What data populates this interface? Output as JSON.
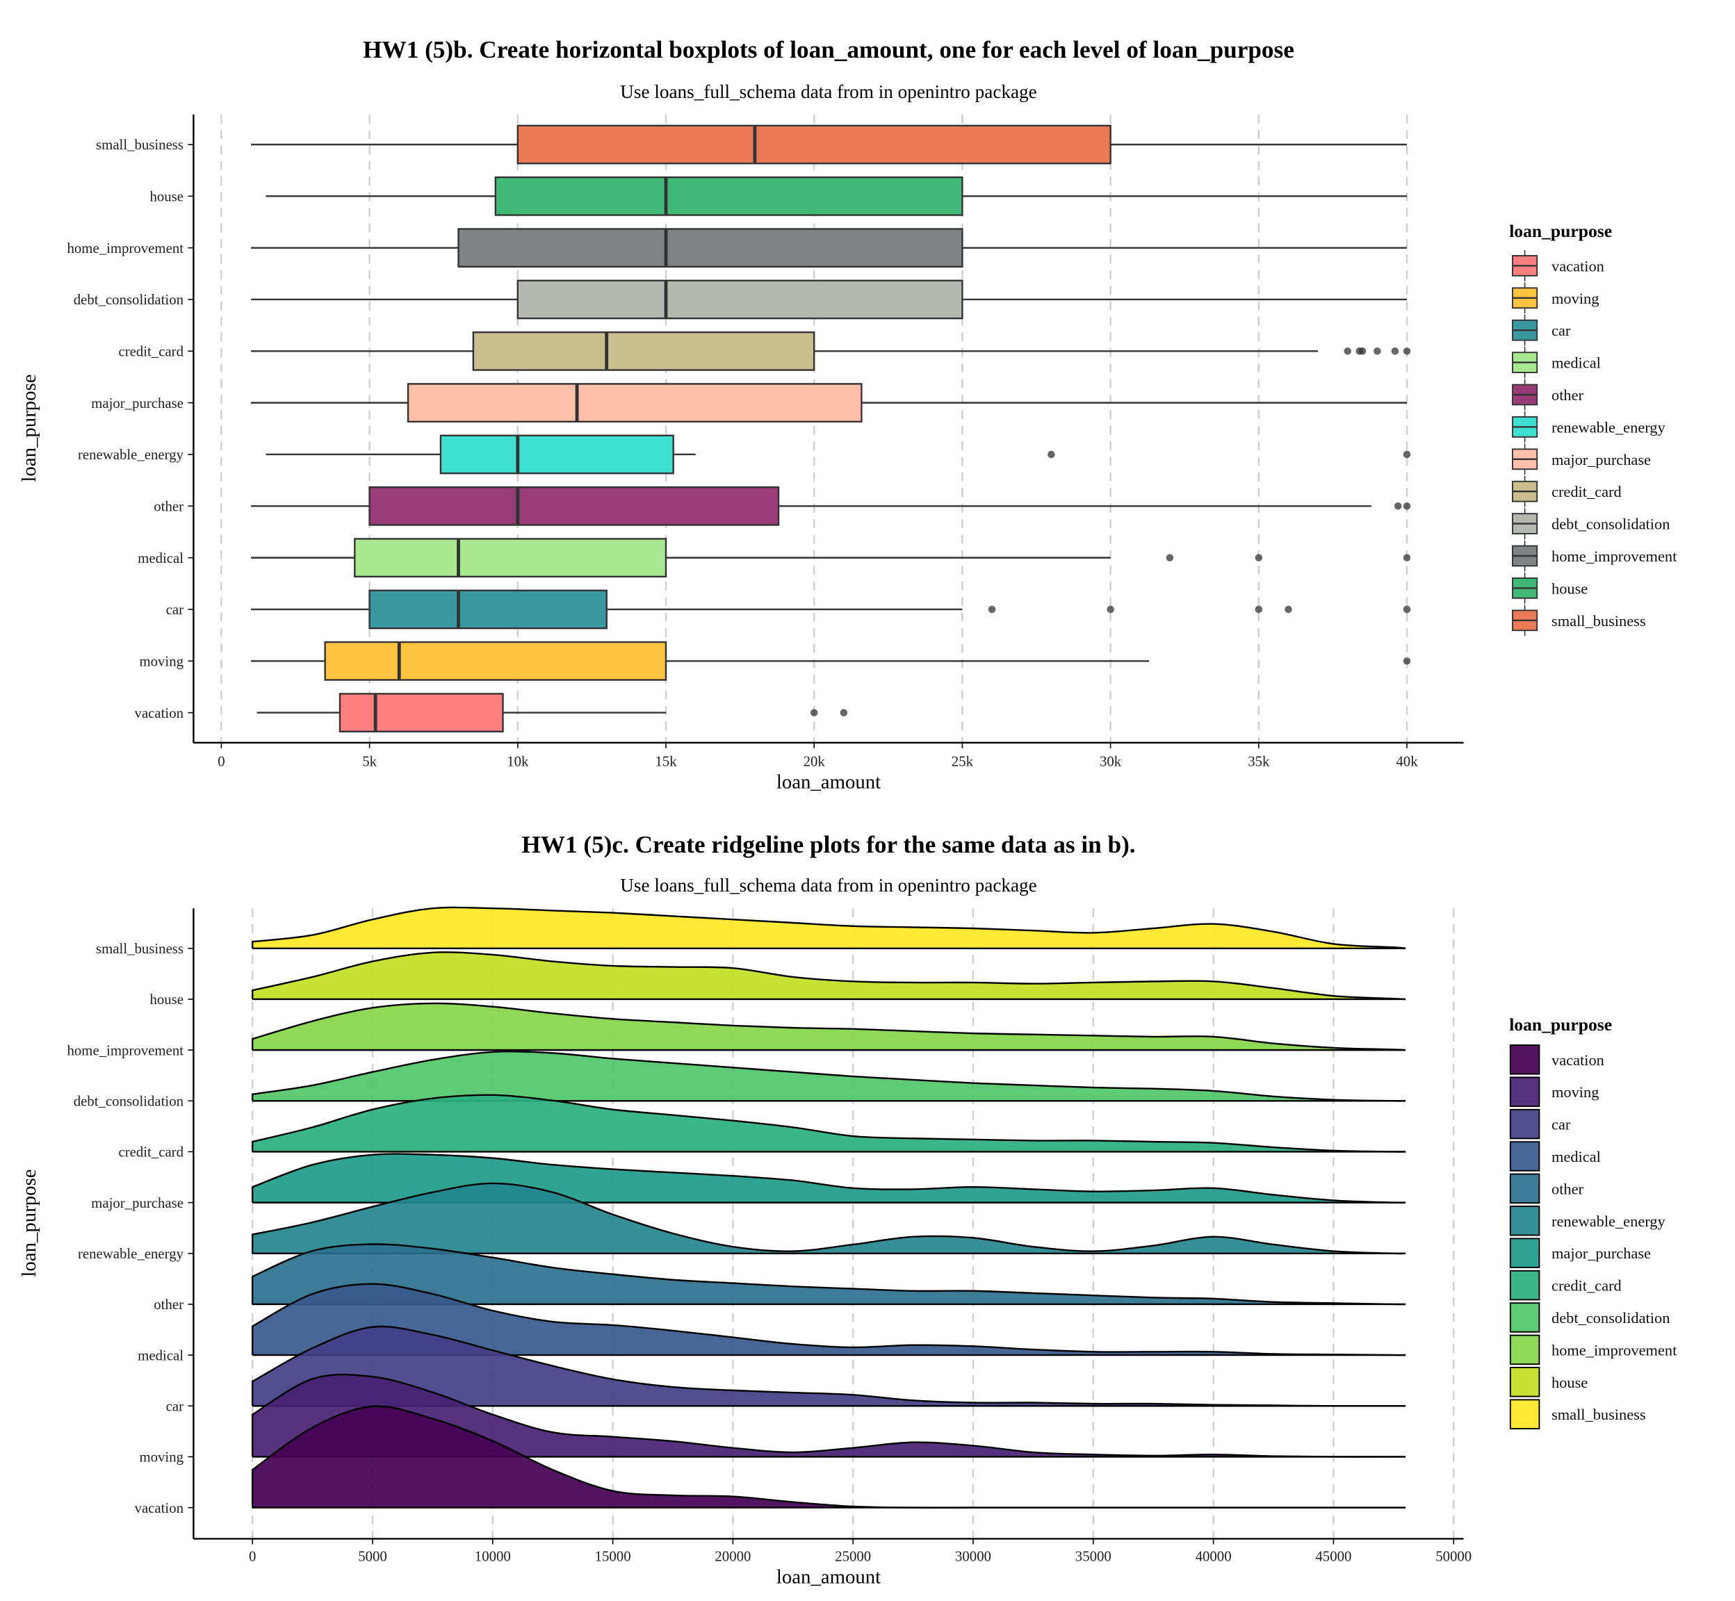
{
  "chart_data": [
    {
      "type": "boxplot",
      "orientation": "horizontal",
      "title": "HW1 (5)b. Create horizontal boxplots of loan_amount, one for each level of loan_purpose",
      "subtitle": "Use loans_full_schema data from in openintro package",
      "xlabel": "loan_amount",
      "ylabel": "loan_purpose",
      "xlim": [
        0,
        40000
      ],
      "x_ticks": [
        0,
        5000,
        10000,
        15000,
        20000,
        25000,
        30000,
        35000,
        40000
      ],
      "x_tick_labels": [
        "0",
        "5k",
        "10k",
        "15k",
        "20k",
        "25k",
        "30k",
        "35k",
        "40k"
      ],
      "grid": "vertical dashed at major x ticks",
      "legend": {
        "title": "loan_purpose",
        "position": "right"
      },
      "categories": [
        "vacation",
        "moving",
        "car",
        "medical",
        "other",
        "renewable_energy",
        "major_purchase",
        "credit_card",
        "debt_consolidation",
        "home_improvement",
        "house",
        "small_business"
      ],
      "series": [
        {
          "name": "vacation",
          "color": "#FF8080",
          "whisker_low": 1200,
          "q1": 4000,
          "median": 5200,
          "q3": 9500,
          "whisker_high": 15000,
          "outliers": [
            20000,
            21000
          ]
        },
        {
          "name": "moving",
          "color": "#FFC440",
          "whisker_low": 1000,
          "q1": 3500,
          "median": 6000,
          "q3": 15000,
          "whisker_high": 31300,
          "outliers": [
            40000
          ]
        },
        {
          "name": "car",
          "color": "#3A98A0",
          "whisker_low": 1000,
          "q1": 5000,
          "median": 8000,
          "q3": 13000,
          "whisker_high": 25000,
          "outliers": [
            26000,
            30000,
            35000,
            36000,
            40000
          ]
        },
        {
          "name": "medical",
          "color": "#A8E890",
          "whisker_low": 1000,
          "q1": 4500,
          "median": 8000,
          "q3": 15000,
          "whisker_high": 30000,
          "outliers": [
            32000,
            35000,
            40000
          ]
        },
        {
          "name": "other",
          "color": "#9A3C78",
          "whisker_low": 1000,
          "q1": 5000,
          "median": 10000,
          "q3": 18800,
          "whisker_high": 38800,
          "outliers": [
            39700,
            40000
          ]
        },
        {
          "name": "renewable_energy",
          "color": "#40E0D0",
          "whisker_low": 1500,
          "q1": 7400,
          "median": 10000,
          "q3": 15250,
          "whisker_high": 16000,
          "outliers": [
            28000,
            40000
          ]
        },
        {
          "name": "major_purchase",
          "color": "#FFBFAA",
          "whisker_low": 1000,
          "q1": 6300,
          "median": 12000,
          "q3": 21600,
          "whisker_high": 40000,
          "outliers": []
        },
        {
          "name": "credit_card",
          "color": "#C8BE8E",
          "whisker_low": 1000,
          "q1": 8500,
          "median": 13000,
          "q3": 20000,
          "whisker_high": 37000,
          "outliers": [
            38000,
            38400,
            38500,
            39000,
            39600,
            40000
          ]
        },
        {
          "name": "debt_consolidation",
          "color": "#B4B8B0",
          "whisker_low": 1000,
          "q1": 10000,
          "median": 15000,
          "q3": 25000,
          "whisker_high": 40000,
          "outliers": []
        },
        {
          "name": "home_improvement",
          "color": "#7F8386",
          "whisker_low": 1000,
          "q1": 8000,
          "median": 15000,
          "q3": 25000,
          "whisker_high": 40000,
          "outliers": []
        },
        {
          "name": "house",
          "color": "#40B878",
          "whisker_low": 1500,
          "q1": 9250,
          "median": 15000,
          "q3": 25000,
          "whisker_high": 40000,
          "outliers": []
        },
        {
          "name": "small_business",
          "color": "#EB7A58",
          "whisker_low": 1000,
          "q1": 10000,
          "median": 18000,
          "q3": 30000,
          "whisker_high": 40000,
          "outliers": []
        }
      ]
    },
    {
      "type": "ridgeline",
      "title": "HW1 (5)c. Create ridgeline plots for the same data as in b).",
      "subtitle": "Use loans_full_schema data from in openintro package",
      "xlabel": "loan_amount",
      "ylabel": "loan_purpose",
      "xlim": [
        0,
        50000
      ],
      "x_ticks": [
        0,
        5000,
        10000,
        15000,
        20000,
        25000,
        30000,
        35000,
        40000,
        45000,
        50000
      ],
      "x_tick_labels": [
        "0",
        "5000",
        "10000",
        "15000",
        "20000",
        "25000",
        "30000",
        "35000",
        "40000",
        "45000",
        "50000"
      ],
      "grid": "vertical dashed at major x ticks",
      "legend": {
        "title": "loan_purpose",
        "position": "right"
      },
      "density_x": [
        0,
        2500,
        5000,
        7500,
        10000,
        12500,
        15000,
        17500,
        20000,
        22500,
        25000,
        27500,
        30000,
        32500,
        35000,
        37500,
        40000,
        42500,
        45000,
        47500,
        48000
      ],
      "categories": [
        "vacation",
        "moving",
        "car",
        "medical",
        "other",
        "renewable_energy",
        "major_purchase",
        "credit_card",
        "debt_consolidation",
        "home_improvement",
        "house",
        "small_business"
      ],
      "series": [
        {
          "name": "vacation",
          "color": "#440154",
          "relative_density": [
            0.34,
            0.72,
            0.91,
            0.8,
            0.6,
            0.34,
            0.15,
            0.11,
            0.1,
            0.05,
            0.01,
            0,
            0,
            0,
            0,
            0,
            0,
            0,
            0,
            0,
            0
          ]
        },
        {
          "name": "moving",
          "color": "#482173",
          "relative_density": [
            0.38,
            0.7,
            0.72,
            0.58,
            0.38,
            0.22,
            0.18,
            0.14,
            0.08,
            0.04,
            0.08,
            0.13,
            0.1,
            0.04,
            0.02,
            0.01,
            0.02,
            0.005,
            0,
            0,
            0
          ]
        },
        {
          "name": "car",
          "color": "#433E85",
          "relative_density": [
            0.22,
            0.52,
            0.71,
            0.64,
            0.5,
            0.36,
            0.24,
            0.17,
            0.14,
            0.12,
            0.1,
            0.05,
            0.03,
            0.03,
            0.02,
            0.02,
            0.01,
            0.005,
            0,
            0,
            0
          ]
        },
        {
          "name": "medical",
          "color": "#38598C",
          "relative_density": [
            0.26,
            0.55,
            0.64,
            0.55,
            0.4,
            0.3,
            0.27,
            0.22,
            0.16,
            0.1,
            0.07,
            0.09,
            0.08,
            0.05,
            0.03,
            0.03,
            0.03,
            0.01,
            0.005,
            0,
            0
          ]
        },
        {
          "name": "other",
          "color": "#2D708E",
          "relative_density": [
            0.25,
            0.48,
            0.54,
            0.5,
            0.42,
            0.33,
            0.27,
            0.22,
            0.19,
            0.16,
            0.14,
            0.12,
            0.12,
            0.1,
            0.08,
            0.06,
            0.05,
            0.02,
            0.01,
            0,
            0
          ]
        },
        {
          "name": "renewable_energy",
          "color": "#25858E",
          "relative_density": [
            0.17,
            0.28,
            0.42,
            0.55,
            0.63,
            0.55,
            0.35,
            0.18,
            0.06,
            0.02,
            0.08,
            0.15,
            0.14,
            0.06,
            0.02,
            0.07,
            0.15,
            0.08,
            0.02,
            0,
            0
          ]
        },
        {
          "name": "major_purchase",
          "color": "#1E9B8A",
          "relative_density": [
            0.14,
            0.34,
            0.43,
            0.43,
            0.4,
            0.34,
            0.3,
            0.27,
            0.24,
            0.2,
            0.13,
            0.12,
            0.14,
            0.12,
            0.1,
            0.11,
            0.13,
            0.07,
            0.02,
            0,
            0
          ]
        },
        {
          "name": "credit_card",
          "color": "#2BB07F",
          "relative_density": [
            0.09,
            0.22,
            0.38,
            0.48,
            0.51,
            0.46,
            0.38,
            0.33,
            0.28,
            0.22,
            0.14,
            0.12,
            0.11,
            0.1,
            0.1,
            0.09,
            0.08,
            0.04,
            0.01,
            0,
            0
          ]
        },
        {
          "name": "debt_consolidation",
          "color": "#51C56A",
          "relative_density": [
            0.06,
            0.14,
            0.26,
            0.37,
            0.44,
            0.43,
            0.38,
            0.34,
            0.3,
            0.26,
            0.22,
            0.19,
            0.16,
            0.14,
            0.12,
            0.11,
            0.09,
            0.04,
            0.01,
            0,
            0
          ]
        },
        {
          "name": "home_improvement",
          "color": "#85D54A",
          "relative_density": [
            0.1,
            0.26,
            0.38,
            0.42,
            0.39,
            0.33,
            0.28,
            0.25,
            0.22,
            0.2,
            0.19,
            0.17,
            0.15,
            0.14,
            0.13,
            0.12,
            0.12,
            0.06,
            0.02,
            0.005,
            0
          ]
        },
        {
          "name": "house",
          "color": "#C2DF23",
          "relative_density": [
            0.08,
            0.2,
            0.34,
            0.42,
            0.4,
            0.34,
            0.3,
            0.29,
            0.28,
            0.2,
            0.16,
            0.15,
            0.15,
            0.14,
            0.15,
            0.16,
            0.16,
            0.1,
            0.03,
            0.005,
            0
          ]
        },
        {
          "name": "small_business",
          "color": "#FDE725",
          "relative_density": [
            0.06,
            0.12,
            0.26,
            0.36,
            0.36,
            0.34,
            0.32,
            0.29,
            0.26,
            0.23,
            0.2,
            0.19,
            0.18,
            0.16,
            0.14,
            0.18,
            0.22,
            0.15,
            0.04,
            0.01,
            0
          ]
        }
      ]
    }
  ]
}
